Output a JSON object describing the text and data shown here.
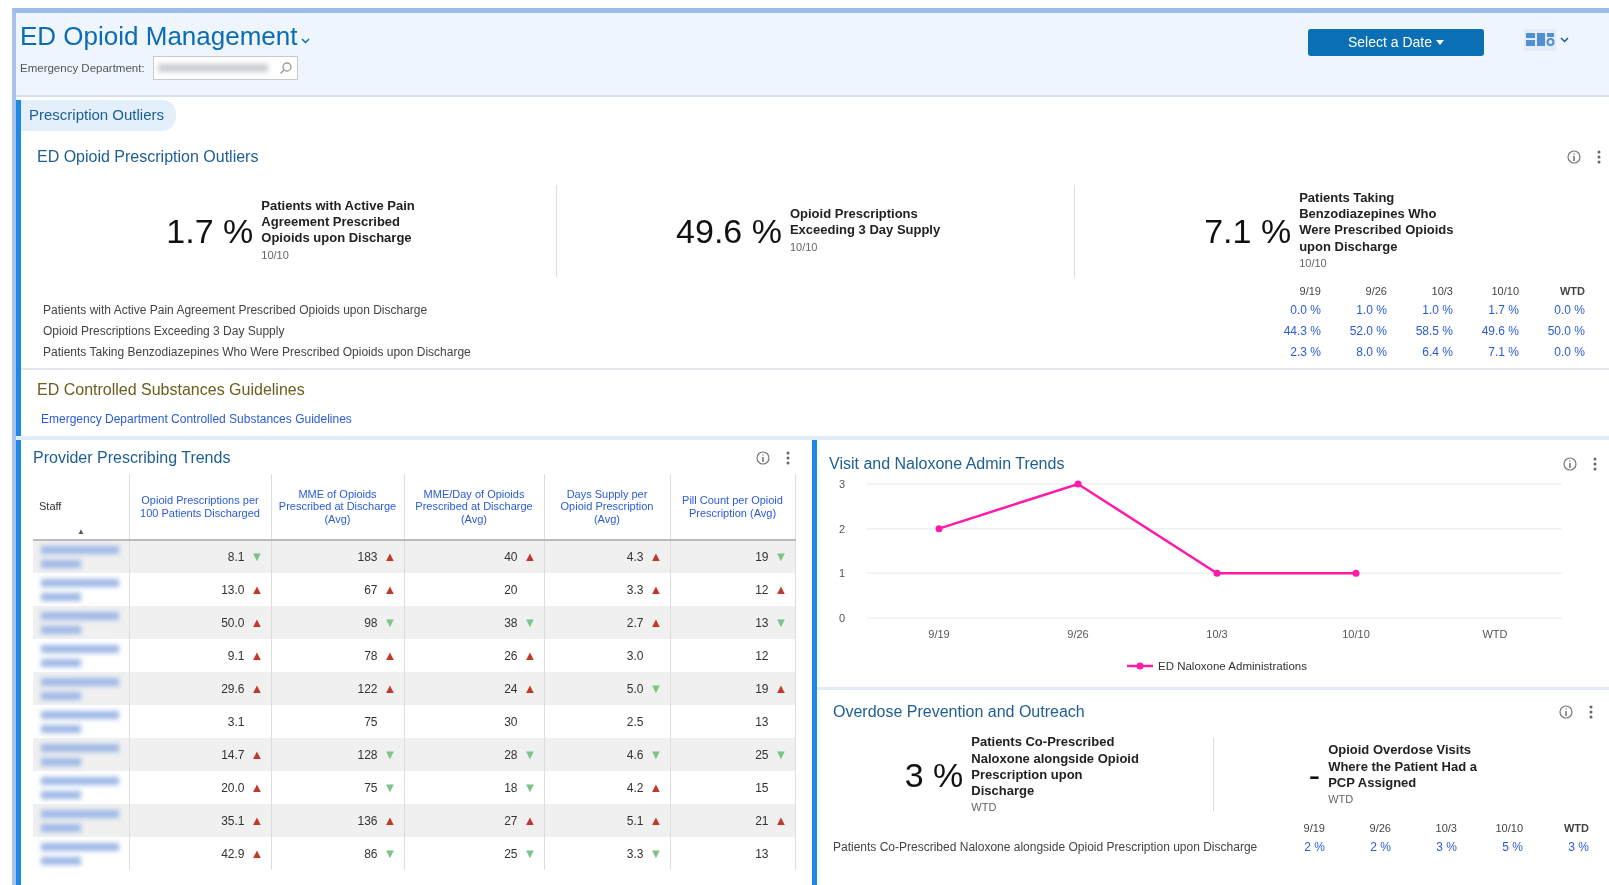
{
  "header": {
    "title": "ED Opioid Management",
    "department_label": "Emergency Department:",
    "date_button": "Select a Date"
  },
  "section_tab": {
    "label": "Prescription Outliers",
    "selected": true
  },
  "outliers": {
    "title": "ED Opioid Prescription Outliers",
    "kpis": [
      {
        "value": "1.7 %",
        "label": "Patients with Active Pain Agreement Prescribed Opioids upon Discharge",
        "period": "10/10"
      },
      {
        "value": "49.6 %",
        "label": "Opioid Prescriptions Exceeding 3 Day Supply",
        "period": "10/10"
      },
      {
        "value": "7.1 %",
        "label": "Patients Taking Benzodiazepines Who Were Prescribed Opioids upon Discharge",
        "period": "10/10"
      }
    ],
    "table": {
      "columns": [
        "9/19",
        "9/26",
        "10/3",
        "10/10",
        "WTD"
      ],
      "rows": [
        {
          "label": "Patients with Active Pain Agreement Prescribed Opioids upon Discharge",
          "values": [
            "0.0 %",
            "1.0 %",
            "1.0 %",
            "1.7 %",
            "0.0 %"
          ]
        },
        {
          "label": "Opioid Prescriptions Exceeding 3 Day Supply",
          "values": [
            "44.3 %",
            "52.0 %",
            "58.5 %",
            "49.6 %",
            "50.0 %"
          ]
        },
        {
          "label": "Patients Taking Benzodiazepines Who Were Prescribed Opioids upon Discharge",
          "values": [
            "2.3 %",
            "8.0 %",
            "6.4 %",
            "7.1 %",
            "0.0 %"
          ]
        }
      ]
    }
  },
  "guidelines": {
    "title": "ED Controlled Substances Guidelines",
    "link": "Emergency Department Controlled Substances Guidelines"
  },
  "provider_trends": {
    "title": "Provider Prescribing Trends",
    "staff_column": "Staff",
    "sort_mark": "▲",
    "columns": [
      "Opioid Prescriptions per 100 Patients Discharged",
      "MME of Opioids Prescribed at Discharge (Avg)",
      "MME/Day of Opioids Prescribed at Discharge (Avg)",
      "Days Supply per Opioid Prescription (Avg)",
      "Pill Count per Opioid Prescription (Avg)"
    ],
    "rows": [
      {
        "cells": [
          {
            "value": "8.1",
            "trend": "▼",
            "color": "#7dc48a"
          },
          {
            "value": "183",
            "trend": "▲",
            "color": "#c0392b"
          },
          {
            "value": "40",
            "trend": "▲",
            "color": "#c0392b"
          },
          {
            "value": "4.3",
            "trend": "▲",
            "color": "#c0392b"
          },
          {
            "value": "19",
            "trend": "▼",
            "color": "#7dc48a"
          }
        ]
      },
      {
        "cells": [
          {
            "value": "13.0",
            "trend": "▲",
            "color": "#c0392b"
          },
          {
            "value": "67",
            "trend": "▲",
            "color": "#c0392b"
          },
          {
            "value": "20"
          },
          {
            "value": "3.3",
            "trend": "▲",
            "color": "#c0392b"
          },
          {
            "value": "12",
            "trend": "▲",
            "color": "#c0392b"
          }
        ]
      },
      {
        "cells": [
          {
            "value": "50.0",
            "trend": "▲",
            "color": "#c0392b"
          },
          {
            "value": "98",
            "trend": "▼",
            "color": "#7dc48a"
          },
          {
            "value": "38",
            "trend": "▼",
            "color": "#7dc48a"
          },
          {
            "value": "2.7",
            "trend": "▲",
            "color": "#c0392b"
          },
          {
            "value": "13",
            "trend": "▼",
            "color": "#7dc48a"
          }
        ]
      },
      {
        "cells": [
          {
            "value": "9.1",
            "trend": "▲",
            "color": "#c0392b"
          },
          {
            "value": "78",
            "trend": "▲",
            "color": "#c0392b"
          },
          {
            "value": "26",
            "trend": "▲",
            "color": "#c0392b"
          },
          {
            "value": "3.0"
          },
          {
            "value": "12"
          }
        ]
      },
      {
        "cells": [
          {
            "value": "29.6",
            "trend": "▲",
            "color": "#c0392b"
          },
          {
            "value": "122",
            "trend": "▲",
            "color": "#c0392b"
          },
          {
            "value": "24",
            "trend": "▲",
            "color": "#c0392b"
          },
          {
            "value": "5.0",
            "trend": "▼",
            "color": "#7dc48a"
          },
          {
            "value": "19",
            "trend": "▲",
            "color": "#c0392b"
          }
        ]
      },
      {
        "cells": [
          {
            "value": "3.1"
          },
          {
            "value": "75"
          },
          {
            "value": "30"
          },
          {
            "value": "2.5"
          },
          {
            "value": "13"
          }
        ]
      },
      {
        "cells": [
          {
            "value": "14.7",
            "trend": "▲",
            "color": "#c0392b"
          },
          {
            "value": "128",
            "trend": "▼",
            "color": "#7dc48a"
          },
          {
            "value": "28",
            "trend": "▼",
            "color": "#7dc48a"
          },
          {
            "value": "4.6",
            "trend": "▼",
            "color": "#7dc48a"
          },
          {
            "value": "25",
            "trend": "▼",
            "color": "#7dc48a"
          }
        ]
      },
      {
        "cells": [
          {
            "value": "20.0",
            "trend": "▲",
            "color": "#c0392b"
          },
          {
            "value": "75",
            "trend": "▼",
            "color": "#7dc48a"
          },
          {
            "value": "18",
            "trend": "▼",
            "color": "#7dc48a"
          },
          {
            "value": "4.2",
            "trend": "▲",
            "color": "#c0392b"
          },
          {
            "value": "15"
          }
        ]
      },
      {
        "cells": [
          {
            "value": "35.1",
            "trend": "▲",
            "color": "#c0392b"
          },
          {
            "value": "136",
            "trend": "▲",
            "color": "#c0392b"
          },
          {
            "value": "27",
            "trend": "▲",
            "color": "#c0392b"
          },
          {
            "value": "5.1",
            "trend": "▲",
            "color": "#c0392b"
          },
          {
            "value": "21",
            "trend": "▲",
            "color": "#c0392b"
          }
        ]
      },
      {
        "cells": [
          {
            "value": "42.9",
            "trend": "▲",
            "color": "#c0392b"
          },
          {
            "value": "86",
            "trend": "▼",
            "color": "#7dc48a"
          },
          {
            "value": "25",
            "trend": "▼",
            "color": "#7dc48a"
          },
          {
            "value": "3.3",
            "trend": "▼",
            "color": "#7dc48a"
          },
          {
            "value": "13"
          }
        ]
      }
    ]
  },
  "naloxone": {
    "title": "Visit and Naloxone Admin Trends",
    "chart_data": {
      "type": "line",
      "categories": [
        "9/19",
        "9/26",
        "10/3",
        "10/10",
        "WTD"
      ],
      "ylim": [
        0,
        3
      ],
      "yticks": [
        0,
        1,
        2,
        3
      ],
      "series": [
        {
          "name": "ED Naloxone Administrations",
          "color": "#ff1aa8",
          "marker": "circle",
          "values": [
            2,
            3,
            1,
            1,
            null
          ]
        }
      ]
    }
  },
  "overdose": {
    "title": "Overdose Prevention and Outreach",
    "kpis": [
      {
        "value": "3 %",
        "label": "Patients Co-Prescribed Naloxone alongside Opioid Prescription upon Discharge",
        "period": "WTD"
      },
      {
        "value": "-",
        "label": "Opioid Overdose Visits Where the Patient Had a PCP Assigned",
        "period": "WTD"
      }
    ],
    "table": {
      "columns": [
        "9/19",
        "9/26",
        "10/3",
        "10/10",
        "WTD"
      ],
      "rows": [
        {
          "label": "Patients Co-Prescribed Naloxone alongside Opioid Prescription upon Discharge",
          "values": [
            "2 %",
            "2 %",
            "3 %",
            "5 %",
            "3 %"
          ]
        }
      ]
    }
  }
}
